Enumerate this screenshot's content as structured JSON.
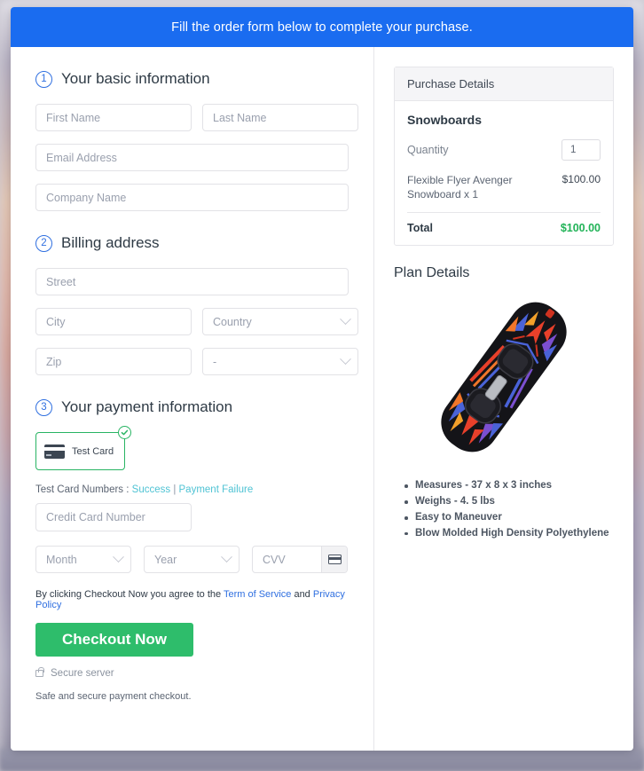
{
  "banner": {
    "text": "Fill the order form below to complete your purchase."
  },
  "sections": {
    "basic": {
      "step": "1",
      "title": "Your basic information",
      "fields": {
        "first_name": "First Name",
        "last_name": "Last Name",
        "email": "Email Address",
        "company": "Company Name"
      }
    },
    "billing": {
      "step": "2",
      "title": "Billing address",
      "fields": {
        "street": "Street",
        "city": "City",
        "country": "Country",
        "zip": "Zip",
        "state": "-"
      }
    },
    "payment": {
      "step": "3",
      "title": "Your payment information",
      "card_option_label": "Test  Card",
      "test_cards_prefix": "Test Card Numbers : ",
      "test_card_success": "Success",
      "test_card_separator": " | ",
      "test_card_failure": "Payment Failure",
      "fields": {
        "credit_card_number": "Credit Card Number",
        "month": "Month",
        "year": "Year",
        "cvv": "CVV"
      },
      "terms_prefix": "By clicking Checkout Now you agree to the ",
      "terms_link": "Term of Service",
      "terms_middle": " and ",
      "privacy_link": "Privacy Policy",
      "checkout_label": "Checkout Now",
      "secure_server": "Secure server",
      "safe_note": "Safe and secure payment checkout."
    }
  },
  "purchase": {
    "header": "Purchase Details",
    "product_group": "Snowboards",
    "quantity_label": "Quantity",
    "quantity_value": "1",
    "line_item_desc": "Flexible Flyer Avenger Snowboard x 1",
    "line_item_price": "$100.00",
    "total_label": "Total",
    "total_value": "$100.00"
  },
  "plan": {
    "title": "Plan Details",
    "features": [
      "Measures - 37 x 8 x 3 inches",
      "Weighs - 4. 5 lbs",
      "Easy to Maneuver",
      "Blow Molded High Density Polyethylene"
    ]
  },
  "colors": {
    "banner_blue": "#1a6cf0",
    "accent_blue": "#2f6fe0",
    "success_green": "#2ebd6b",
    "total_green": "#22b358",
    "link_teal": "#4fc3d4"
  }
}
